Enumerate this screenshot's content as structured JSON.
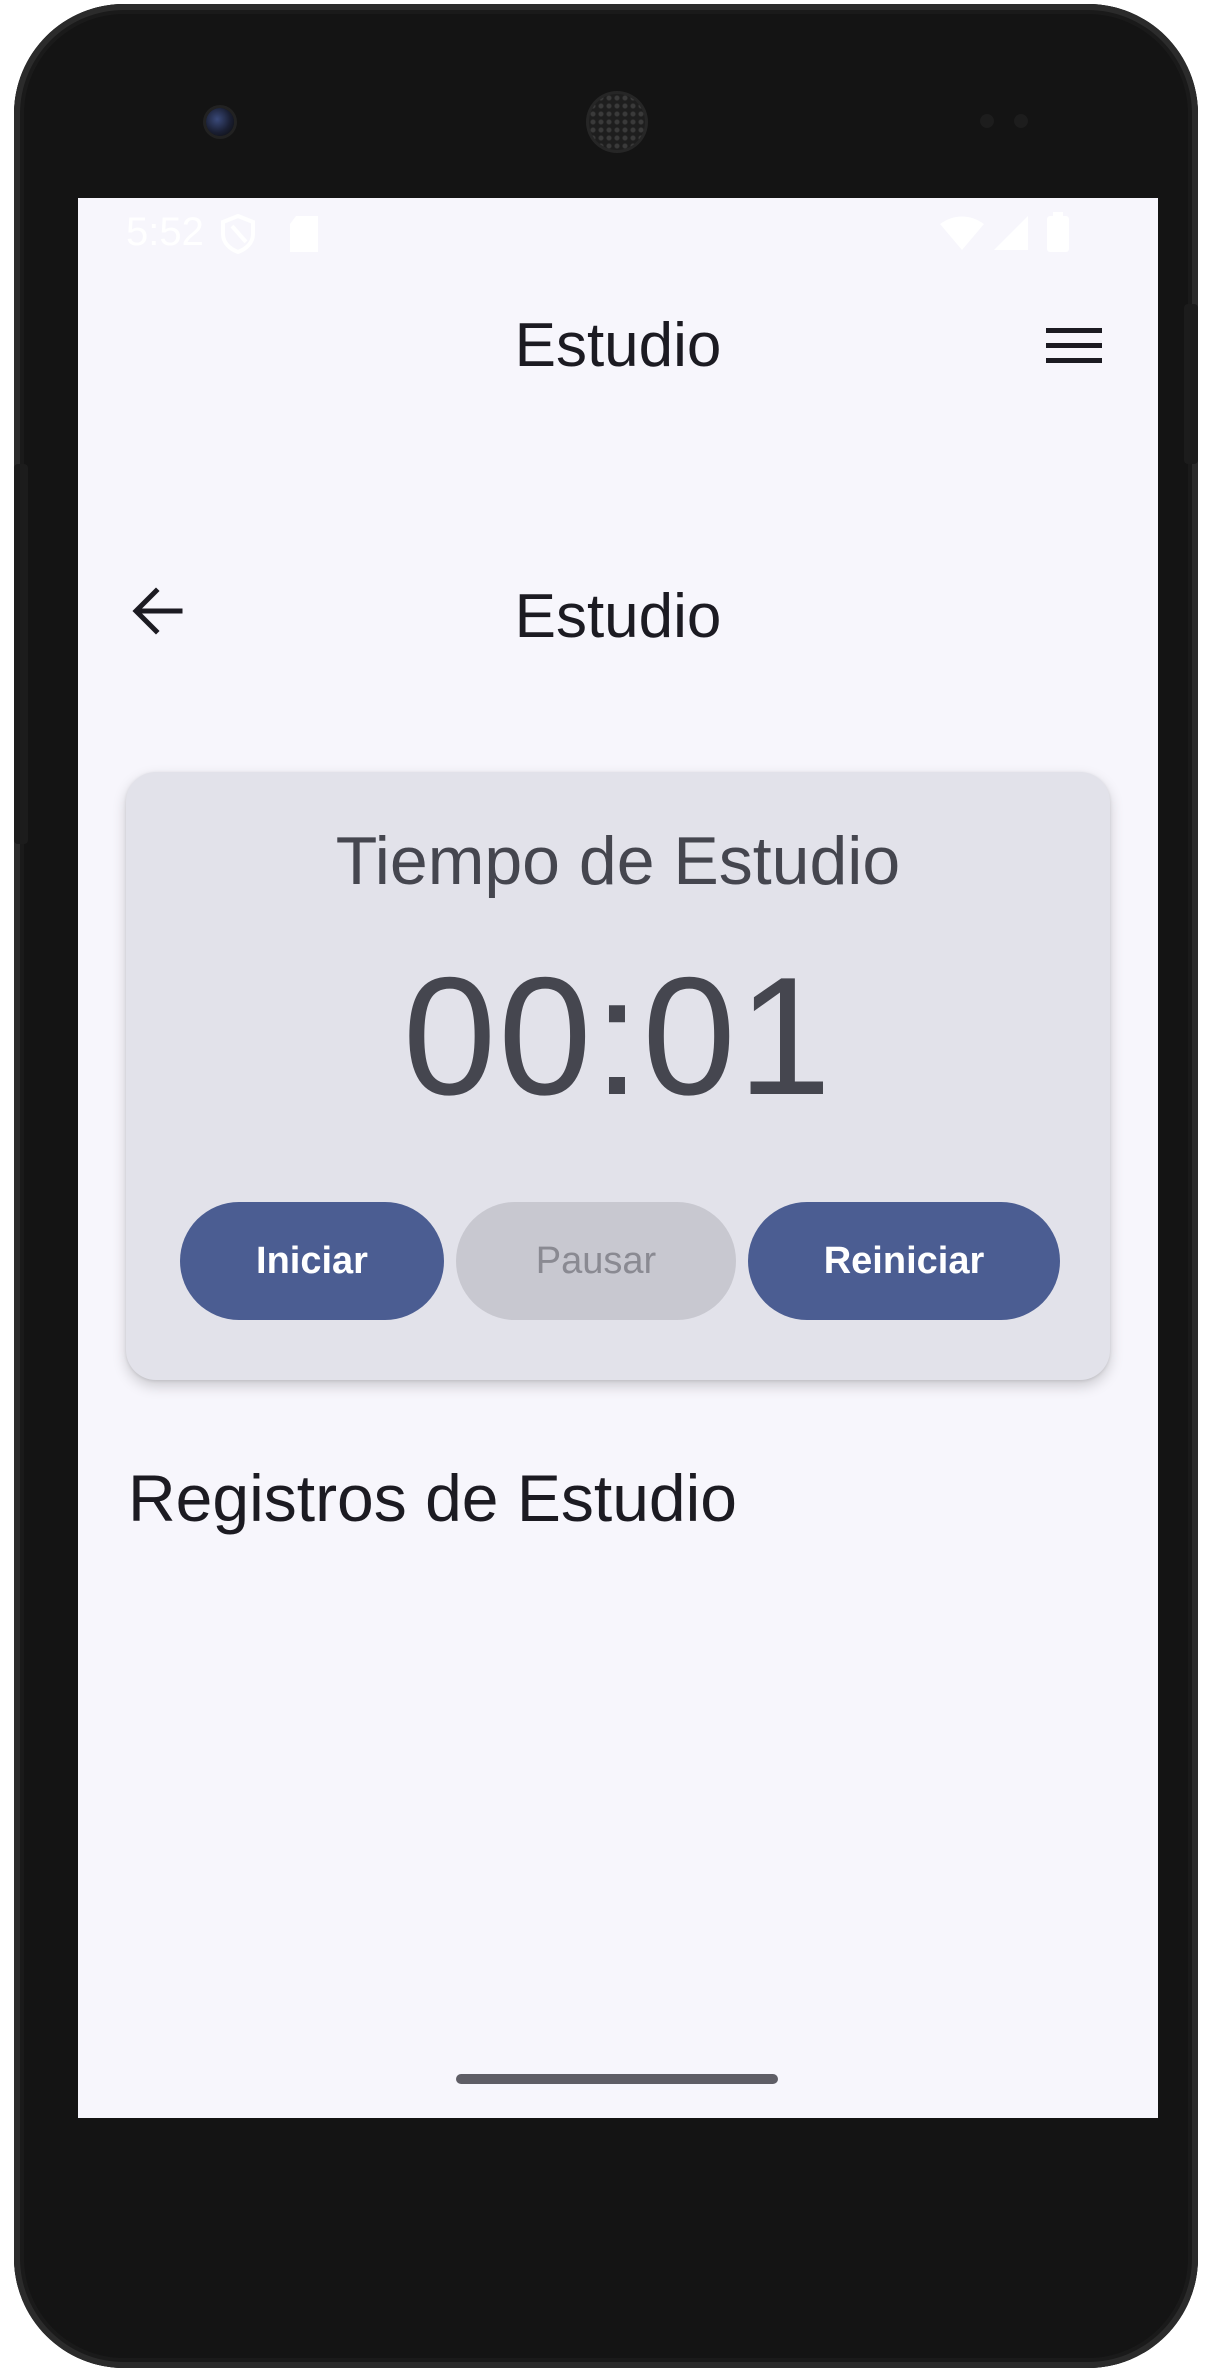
{
  "status_bar": {
    "time": "5:52"
  },
  "top_bar": {
    "title": "Estudio",
    "menu_icon": "menu-icon"
  },
  "sub_bar": {
    "title": "Estudio",
    "back_icon": "arrow-back-icon"
  },
  "timer": {
    "label": "Tiempo de Estudio",
    "value": "00:01",
    "buttons": {
      "start": "Iniciar",
      "pause": "Pausar",
      "reset": "Reiniciar"
    }
  },
  "records": {
    "title": "Registros de Estudio"
  },
  "colors": {
    "background": "#f7f6fc",
    "card": "#e2e2ea",
    "primary": "#4b5d92",
    "disabled": "#c8c8d0",
    "text": "#1c1b22"
  }
}
